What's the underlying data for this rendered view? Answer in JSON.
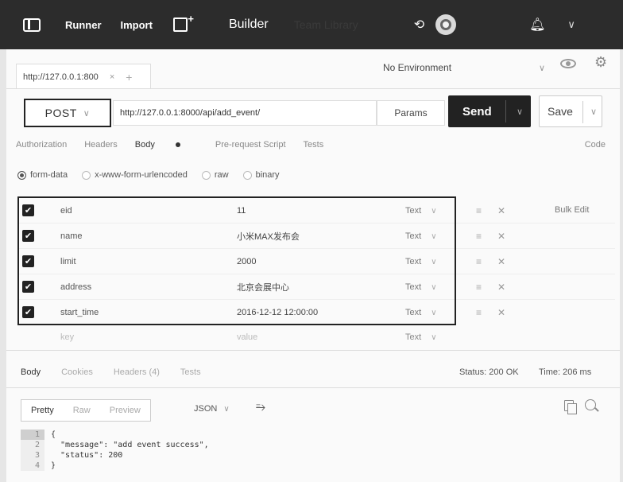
{
  "topbar": {
    "runner": "Runner",
    "import": "Import",
    "builder": "Builder",
    "team_library": "Team Library"
  },
  "tab": {
    "title": "http://127.0.0.1:800",
    "close": "×",
    "add": "+"
  },
  "environment": {
    "selected": "No Environment"
  },
  "request": {
    "method": "POST",
    "url": "http://127.0.0.1:8000/api/add_event/",
    "params_label": "Params",
    "send_label": "Send",
    "save_label": "Save"
  },
  "request_tabs": {
    "authorization": "Authorization",
    "headers": "Headers",
    "body": "Body",
    "prerequest": "Pre-request Script",
    "tests": "Tests",
    "code": "Code"
  },
  "body_types": {
    "form_data": "form-data",
    "urlencoded": "x-www-form-urlencoded",
    "raw": "raw",
    "binary": "binary"
  },
  "form_rows": [
    {
      "key": "eid",
      "value": "11",
      "type": "Text"
    },
    {
      "key": "name",
      "value": "小米MAX发布会",
      "type": "Text"
    },
    {
      "key": "limit",
      "value": "2000",
      "type": "Text"
    },
    {
      "key": "address",
      "value": "北京会展中心",
      "type": "Text"
    },
    {
      "key": "start_time",
      "value": "2016-12-12 12:00:00",
      "type": "Text"
    }
  ],
  "form_placeholder": {
    "key": "key",
    "value": "value",
    "type": "Text"
  },
  "bulk_edit": "Bulk Edit",
  "response": {
    "tabs": {
      "body": "Body",
      "cookies": "Cookies",
      "headers": "Headers (4)",
      "tests": "Tests"
    },
    "status": "Status: 200 OK",
    "time": "Time: 206 ms",
    "view_modes": {
      "pretty": "Pretty",
      "raw": "Raw",
      "preview": "Preview"
    },
    "format": "JSON",
    "code_lines": [
      {
        "n": "1",
        "text": "{"
      },
      {
        "n": "2",
        "text": "  \"message\": \"add event success\","
      },
      {
        "n": "3",
        "text": "  \"status\": 200"
      },
      {
        "n": "4",
        "text": "}"
      }
    ]
  }
}
